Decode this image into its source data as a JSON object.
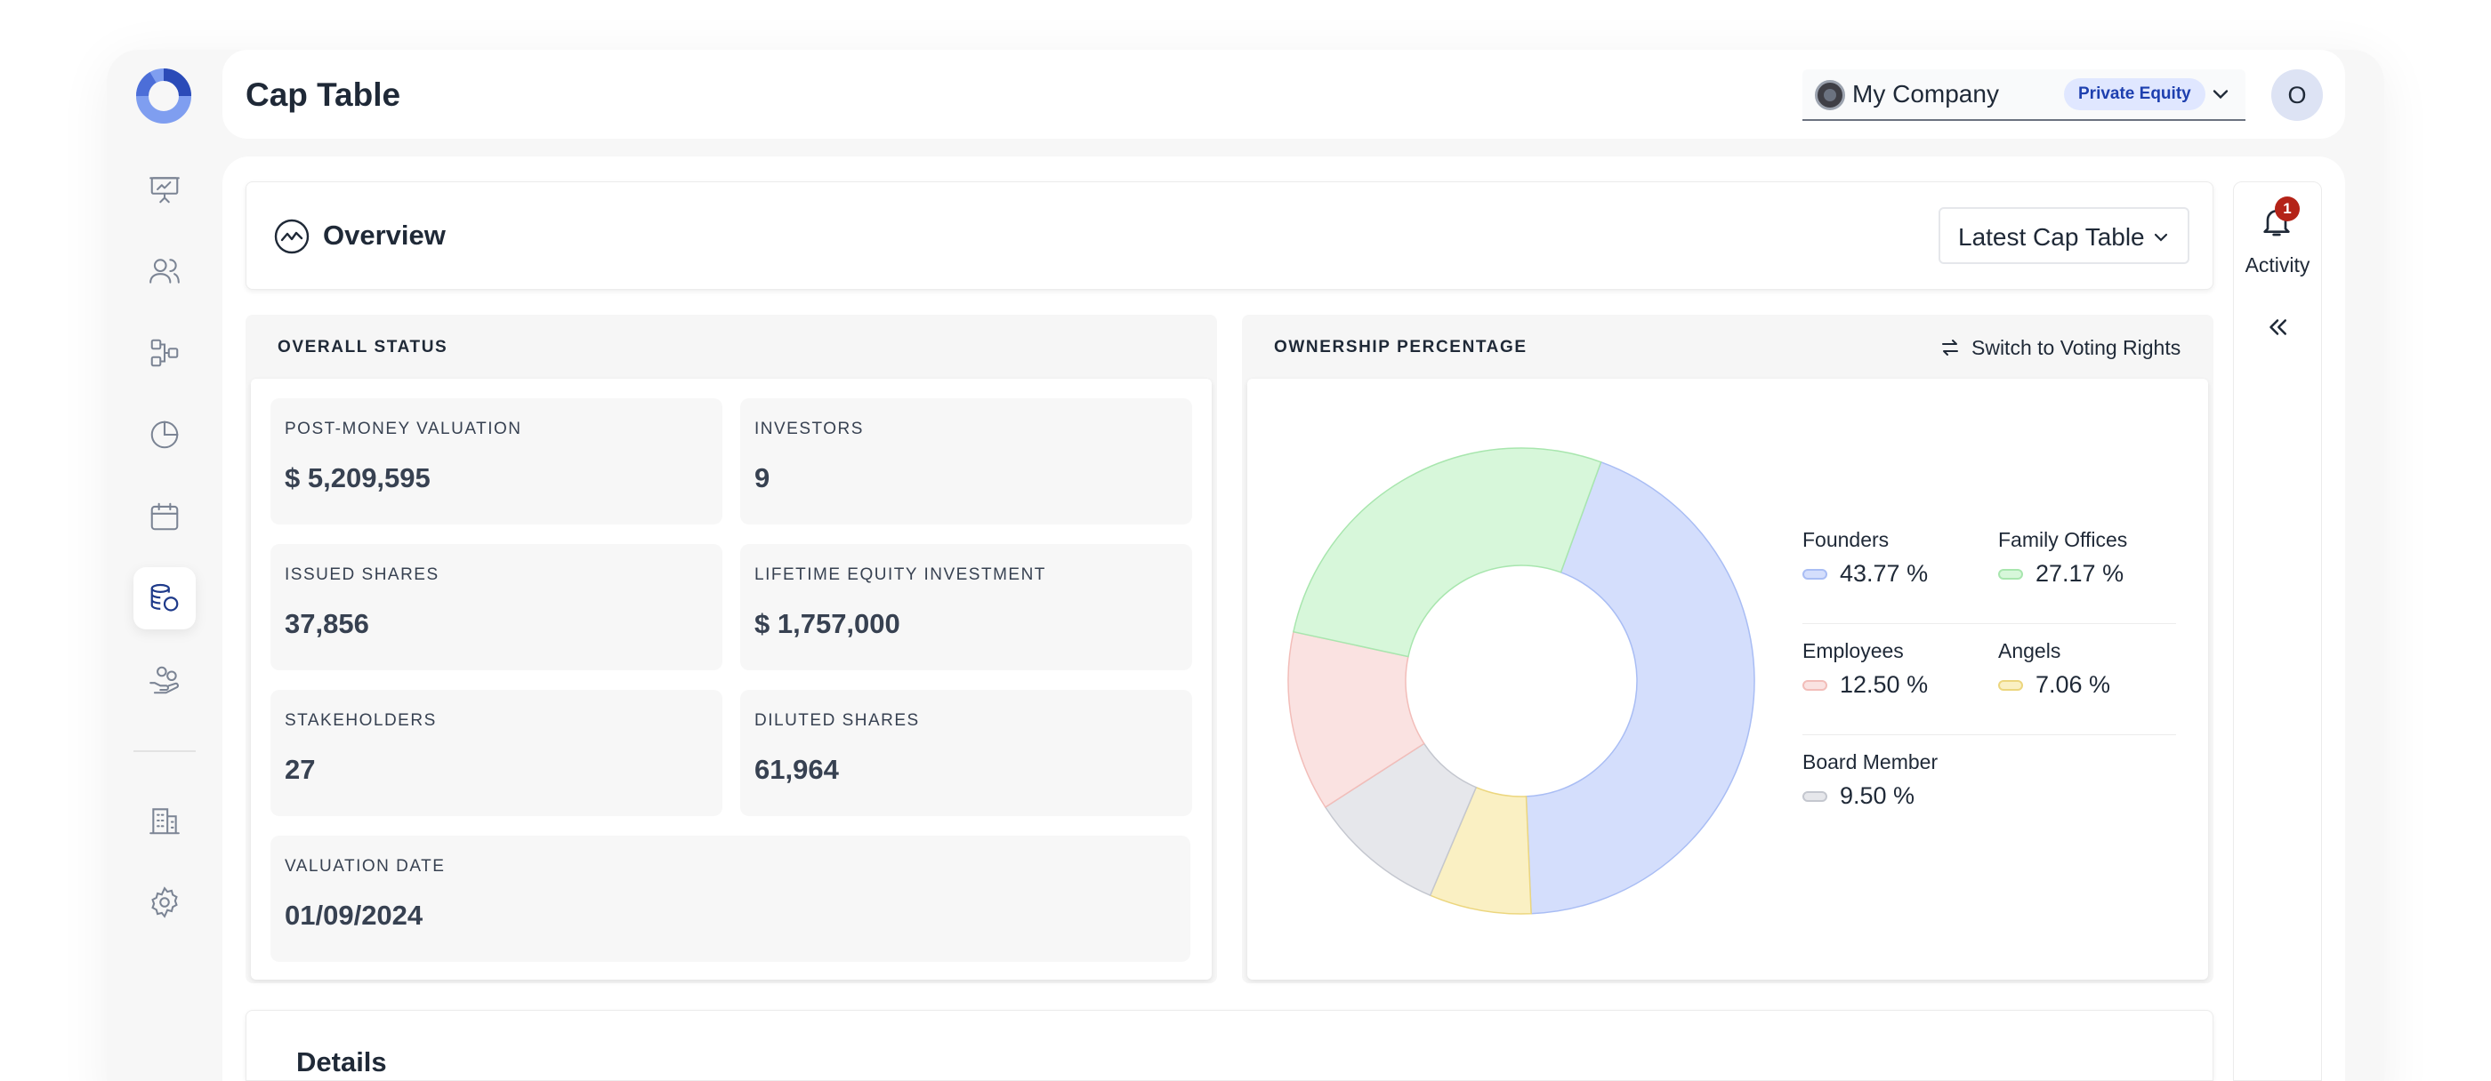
{
  "header": {
    "title": "Cap Table",
    "company": {
      "name": "My Company",
      "badge": "Private Equity"
    },
    "avatar_initial": "O"
  },
  "sidebar": {
    "items": [
      {
        "icon": "presentation-icon",
        "active": false
      },
      {
        "icon": "users-icon",
        "active": false
      },
      {
        "icon": "flowchart-icon",
        "active": false
      },
      {
        "icon": "pie-chart-icon",
        "active": false
      },
      {
        "icon": "calendar-icon",
        "active": false
      },
      {
        "icon": "coins-icon",
        "active": true
      },
      {
        "icon": "hand-coins-icon",
        "active": false
      },
      {
        "icon": "building-icon",
        "active": false
      },
      {
        "icon": "gear-icon",
        "active": false
      }
    ]
  },
  "overview": {
    "title": "Overview",
    "selector": "Latest Cap Table"
  },
  "activity": {
    "label": "Activity",
    "count": "1"
  },
  "overall_status": {
    "heading": "OVERALL STATUS",
    "stats": [
      {
        "label": "POST-MONEY VALUATION",
        "value": "$ 5,209,595"
      },
      {
        "label": "INVESTORS",
        "value": "9"
      },
      {
        "label": "ISSUED SHARES",
        "value": "37,856"
      },
      {
        "label": "LIFETIME EQUITY INVESTMENT",
        "value": "$ 1,757,000"
      },
      {
        "label": "STAKEHOLDERS",
        "value": "27"
      },
      {
        "label": "DILUTED SHARES",
        "value": "61,964"
      },
      {
        "label": "VALUATION DATE",
        "value": "01/09/2024"
      }
    ]
  },
  "ownership": {
    "heading": "OWNERSHIP PERCENTAGE",
    "switch_label": "Switch to Voting Rights"
  },
  "chart_data": {
    "type": "pie",
    "donut": true,
    "categories": [
      "Founders",
      "Family Offices",
      "Employees",
      "Angels",
      "Board Member"
    ],
    "values": [
      43.77,
      27.17,
      12.5,
      7.06,
      9.5
    ],
    "value_labels": [
      "43.77 %",
      "27.17 %",
      "12.50 %",
      "7.06 %",
      "9.50 %"
    ],
    "colors": [
      "#d4defc",
      "#d7f7da",
      "#fae2e1",
      "#faf0c3",
      "#e6e7eb"
    ],
    "strokes": [
      "#a9bdf4",
      "#a8e6ae",
      "#f2bdb9",
      "#ecd67e",
      "#c4c7cf"
    ],
    "draw_order": [
      0,
      3,
      4,
      2,
      1
    ],
    "legend_position": "right"
  },
  "details": {
    "title": "Details"
  }
}
